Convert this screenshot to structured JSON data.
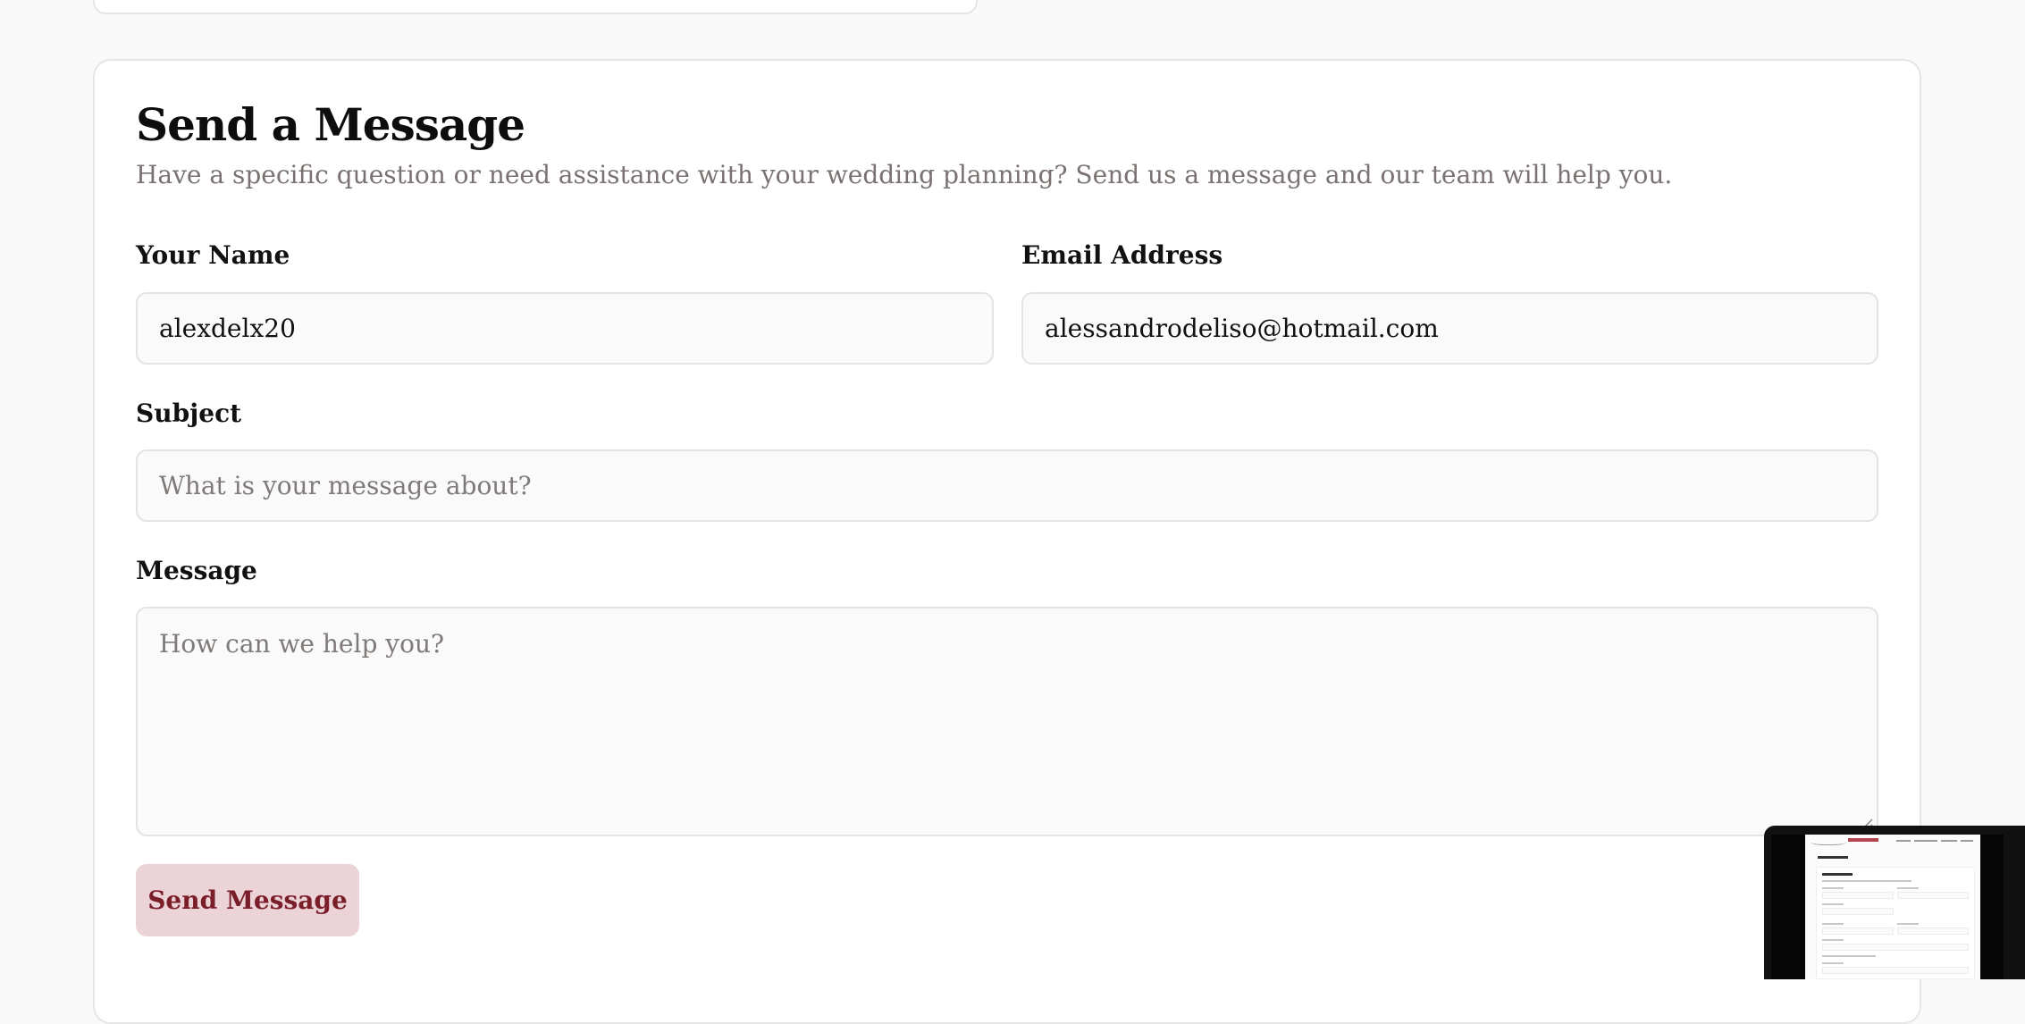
{
  "form": {
    "title": "Send a Message",
    "subtitle": "Have a specific question or need assistance with your wedding planning? Send us a message and our team will help you.",
    "name": {
      "label": "Your Name",
      "value": "alexdelx20"
    },
    "email": {
      "label": "Email Address",
      "value": "alessandrodeliso@hotmail.com"
    },
    "subject": {
      "label": "Subject",
      "value": "",
      "placeholder": "What is your message about?"
    },
    "message": {
      "label": "Message",
      "value": "",
      "placeholder": "How can we help you?"
    },
    "submit_label": "Send Message"
  },
  "colors": {
    "page_background": "#f9f9f9",
    "card_background": "#ffffff",
    "button_background": "#ecd3d8",
    "button_text": "#7a1f2a",
    "muted_text": "#7a7270",
    "field_background": "#fafafa",
    "field_border": "#e3e3e3"
  },
  "icons": {
    "resize_handle": "resize-handle-icon"
  }
}
